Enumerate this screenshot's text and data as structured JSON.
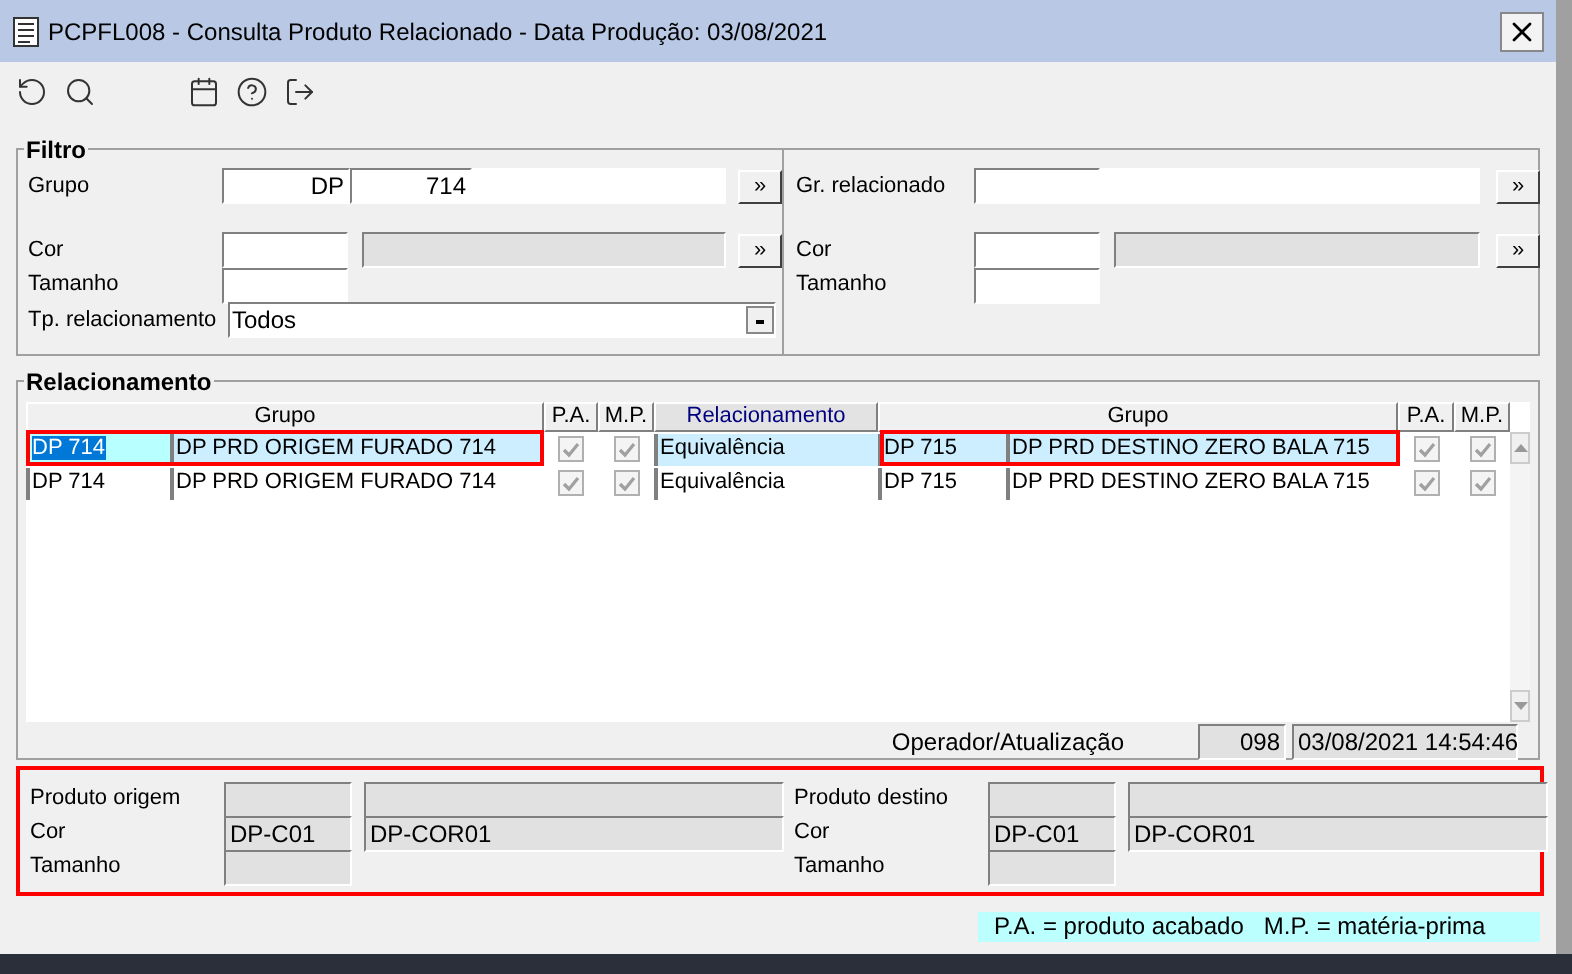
{
  "window": {
    "title": "PCPFL008 - Consulta Produto Relacionado - Data Produção: 03/08/2021"
  },
  "filter": {
    "title": "Filtro",
    "left": {
      "grupo_label": "Grupo",
      "grupo_prefix": "DP",
      "grupo_code": "714",
      "cor_label": "Cor",
      "tamanho_label": "Tamanho",
      "tipo_label": "Tp. relacionamento",
      "tipo_value": "Todos",
      "lookup_button": "»"
    },
    "right": {
      "grupo_label": "Gr. relacionado",
      "cor_label": "Cor",
      "tamanho_label": "Tamanho",
      "lookup_button": "»"
    }
  },
  "relations": {
    "title": "Relacionamento",
    "columns": {
      "grupo": "Grupo",
      "pa": "P.A.",
      "mp": "M.P.",
      "relacionamento": "Relacionamento",
      "grupo_rel": "Grupo",
      "pa_rel": "P.A.",
      "mp_rel": "M.P."
    },
    "rows": [
      {
        "selected": true,
        "code": "DP 714",
        "desc": "DP PRD ORIGEM FURADO 714",
        "pa": true,
        "mp": true,
        "rel": "Equivalência",
        "code_rel": "DP 715",
        "desc_rel": "DP PRD DESTINO ZERO BALA 715",
        "pa_rel": true,
        "mp_rel": true
      },
      {
        "selected": false,
        "code": "DP 714",
        "desc": "DP PRD ORIGEM FURADO 714",
        "pa": true,
        "mp": true,
        "rel": "Equivalência",
        "code_rel": "DP 715",
        "desc_rel": "DP PRD DESTINO ZERO BALA 715",
        "pa_rel": true,
        "mp_rel": true
      }
    ],
    "operator_label": "Operador/Atualização",
    "operator": "098",
    "updated": "03/08/2021 14:54:46"
  },
  "details": {
    "origin": {
      "label": "Produto origem",
      "cor_label": "Cor",
      "cor_code": "DP-C01",
      "cor_name": "DP-COR01",
      "tamanho_label": "Tamanho"
    },
    "destination": {
      "label": "Produto destino",
      "cor_label": "Cor",
      "cor_code": "DP-C01",
      "cor_name": "DP-COR01",
      "tamanho_label": "Tamanho"
    }
  },
  "legend": "P.A. = produto acabado   M.P. = matéria-prima"
}
